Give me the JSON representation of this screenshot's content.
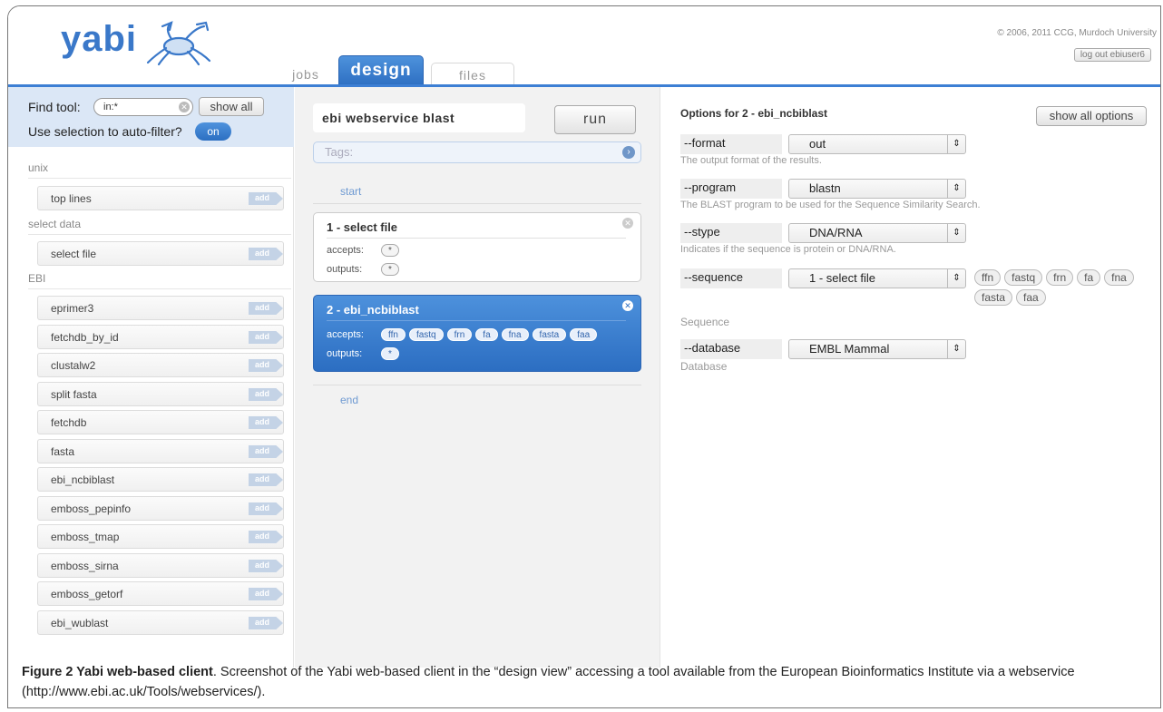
{
  "header": {
    "logo": "yabi",
    "copyright": "© 2006, 2011 CCG, Murdoch University",
    "logout": "log out ebiuser6",
    "tabs": [
      "jobs",
      "design",
      "files"
    ]
  },
  "left": {
    "find_label": "Find tool:",
    "find_value": "in:*",
    "show_all": "show all",
    "autofilter_label": "Use selection to auto-filter?",
    "autofilter_state": "on",
    "add_label": "add",
    "groups": [
      {
        "name": "unix",
        "tools": [
          "top lines"
        ]
      },
      {
        "name": "select data",
        "tools": [
          "select file"
        ]
      },
      {
        "name": "EBI",
        "tools": [
          "eprimer3",
          "fetchdb_by_id",
          "clustalw2",
          "split fasta",
          "fetchdb",
          "fasta",
          "ebi_ncbiblast",
          "emboss_pepinfo",
          "emboss_tmap",
          "emboss_sirna",
          "emboss_getorf",
          "ebi_wublast"
        ]
      }
    ]
  },
  "middle": {
    "workflow_name": "ebi webservice blast",
    "run": "run",
    "tags_placeholder": "Tags:",
    "start": "start",
    "end": "end",
    "accepts_label": "accepts:",
    "outputs_label": "outputs:",
    "jobs": [
      {
        "title": "1 - select file",
        "accepts": [
          "*"
        ],
        "outputs": [
          "*"
        ]
      },
      {
        "title": "2 - ebi_ncbiblast",
        "accepts": [
          "ffn",
          "fastq",
          "frn",
          "fa",
          "fna",
          "fasta",
          "faa"
        ],
        "outputs": [
          "*"
        ]
      }
    ]
  },
  "right": {
    "title": "Options for 2 - ebi_ncbiblast",
    "show_all_options": "show all options",
    "options": [
      {
        "name": "--format",
        "value": "out",
        "help": "The output format of the results."
      },
      {
        "name": "--program",
        "value": "blastn",
        "help": "The BLAST program to be used for the Sequence Similarity Search."
      },
      {
        "name": "--stype",
        "value": "DNA/RNA",
        "help": "Indicates if the sequence is protein or DNA/RNA."
      },
      {
        "name": "--sequence",
        "value": "1 - select file",
        "help": "Sequence",
        "filetypes": [
          "ffn",
          "fastq",
          "frn",
          "fa",
          "fna",
          "fasta",
          "faa"
        ]
      },
      {
        "name": "--database",
        "value": "EMBL Mammal",
        "help": "Database"
      }
    ]
  },
  "caption": {
    "label": "Figure 2 Yabi web-based client",
    "text": ". Screenshot of the Yabi web-based client in the “design view” accessing a tool available from the European Bioinformatics Institute via a webservice (http://www.ebi.ac.uk/Tools/webservices/)."
  },
  "colors": {
    "accent": "#3d7fd4",
    "panel": "#dbe7f6",
    "middle_bg": "#f2f2f2"
  },
  "icons": [
    "crab-logo-icon",
    "clear-icon",
    "close-icon",
    "arrow-right-icon",
    "select-arrows-icon"
  ]
}
